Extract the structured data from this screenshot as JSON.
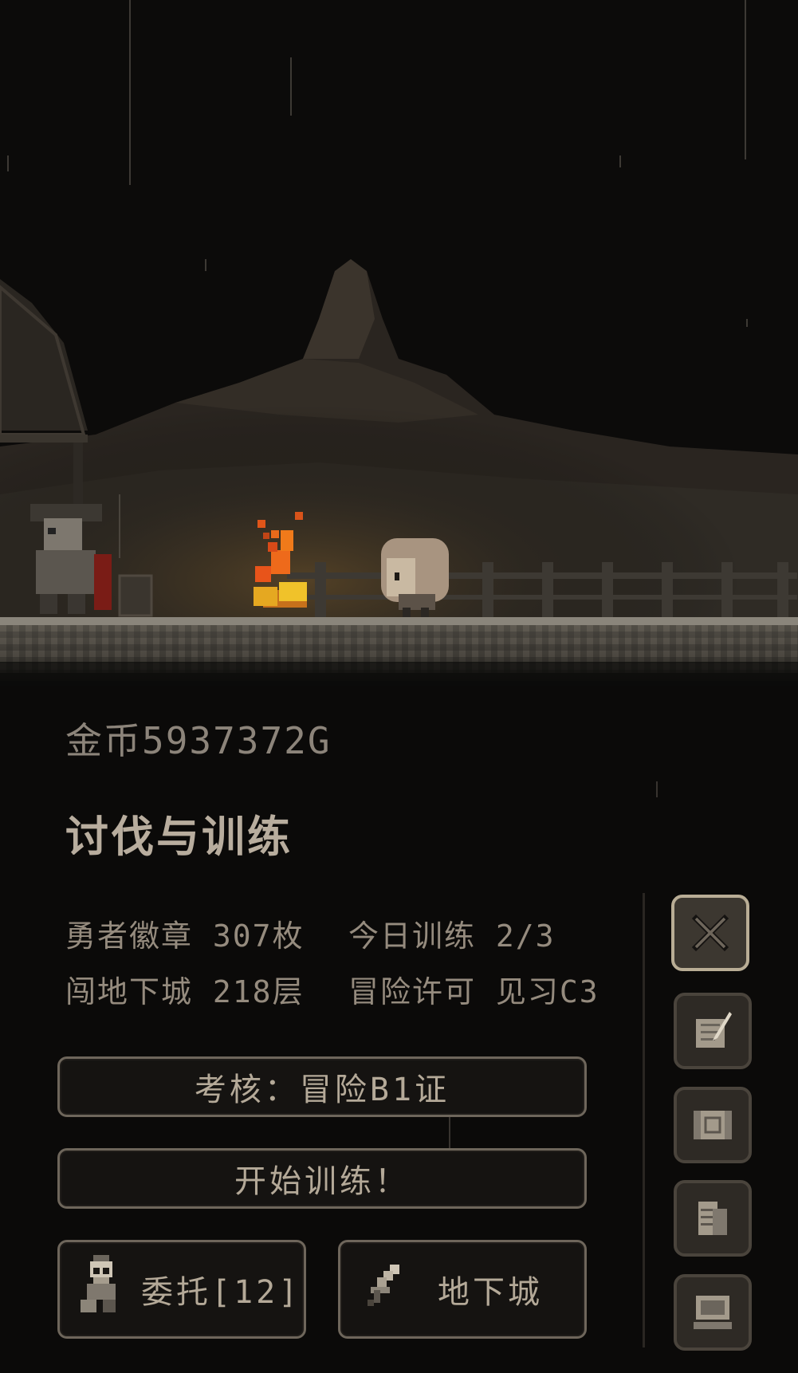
{
  "status": {
    "gold": "金币5937372G"
  },
  "section_title": "讨伐与训练",
  "stats": {
    "badge": "勇者徽章 307枚",
    "training_today": "今日训练 2/3",
    "dungeon": "闯地下城 218层",
    "license": "冒险许可 见习C3"
  },
  "buttons": {
    "exam": "考核：冒险B1证",
    "start_training": "开始训练！",
    "quest": "委托[12]",
    "dungeon": "地下城"
  },
  "side_menu": [
    {
      "icon": "crossed-swords-icon",
      "active": true
    },
    {
      "icon": "quill-paper-icon",
      "active": false
    },
    {
      "icon": "map-icon",
      "active": false
    },
    {
      "icon": "documents-icon",
      "active": false
    },
    {
      "icon": "computer-icon",
      "active": false
    }
  ],
  "colors": {
    "background": "#0b0a09",
    "text": "#a89e90",
    "fire": "#f07a1a",
    "button_border": "#6e665b"
  }
}
